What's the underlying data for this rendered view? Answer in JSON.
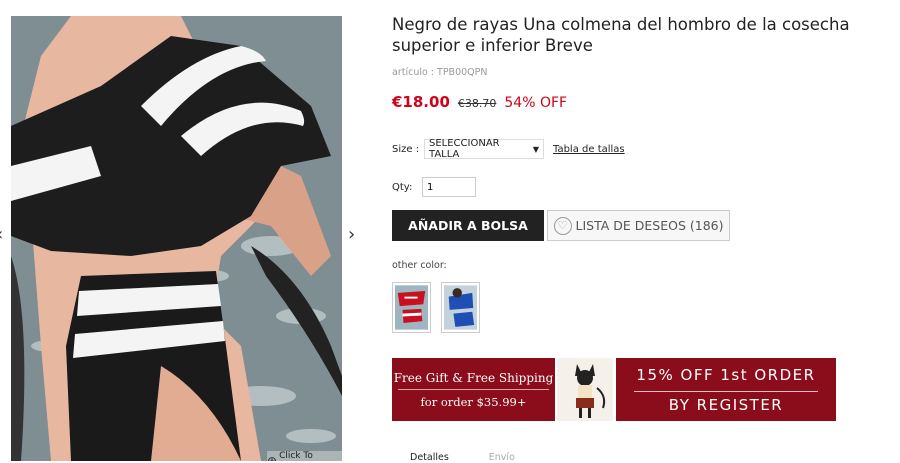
{
  "gallery": {
    "enlarge_label": "Click To Enlarge",
    "prev_arrow": "‹",
    "next_arrow": "›"
  },
  "product": {
    "title": "Negro de rayas Una colmena del hombro de la cosecha superior e inferior Breve",
    "sku": "artículo : TPB00QPN",
    "price_now": "€18.00",
    "price_old": "€38.70",
    "discount": "54% OFF"
  },
  "size": {
    "label": "Size :",
    "selected": "SELECCIONAR TALLA",
    "chart_link": "Tabla de tallas"
  },
  "qty": {
    "label": "Qty:",
    "value": "1"
  },
  "actions": {
    "add_to_bag": "AÑADIR A BOLSA",
    "wishlist": "LISTA DE DESEOS (186)"
  },
  "other_color": {
    "label": "other color:"
  },
  "promos": {
    "gift_line1": "Free Gift & Free Shipping",
    "gift_line2": "for order $35.99+",
    "register_line1": "15% OFF 1st ORDER",
    "register_line2": "BY REGISTER"
  },
  "tabs": [
    "Detalles",
    "Envío"
  ],
  "colors": {
    "accent_red": "#d0021b",
    "promo_red": "#8b0c1a",
    "button_dark": "#222222"
  }
}
